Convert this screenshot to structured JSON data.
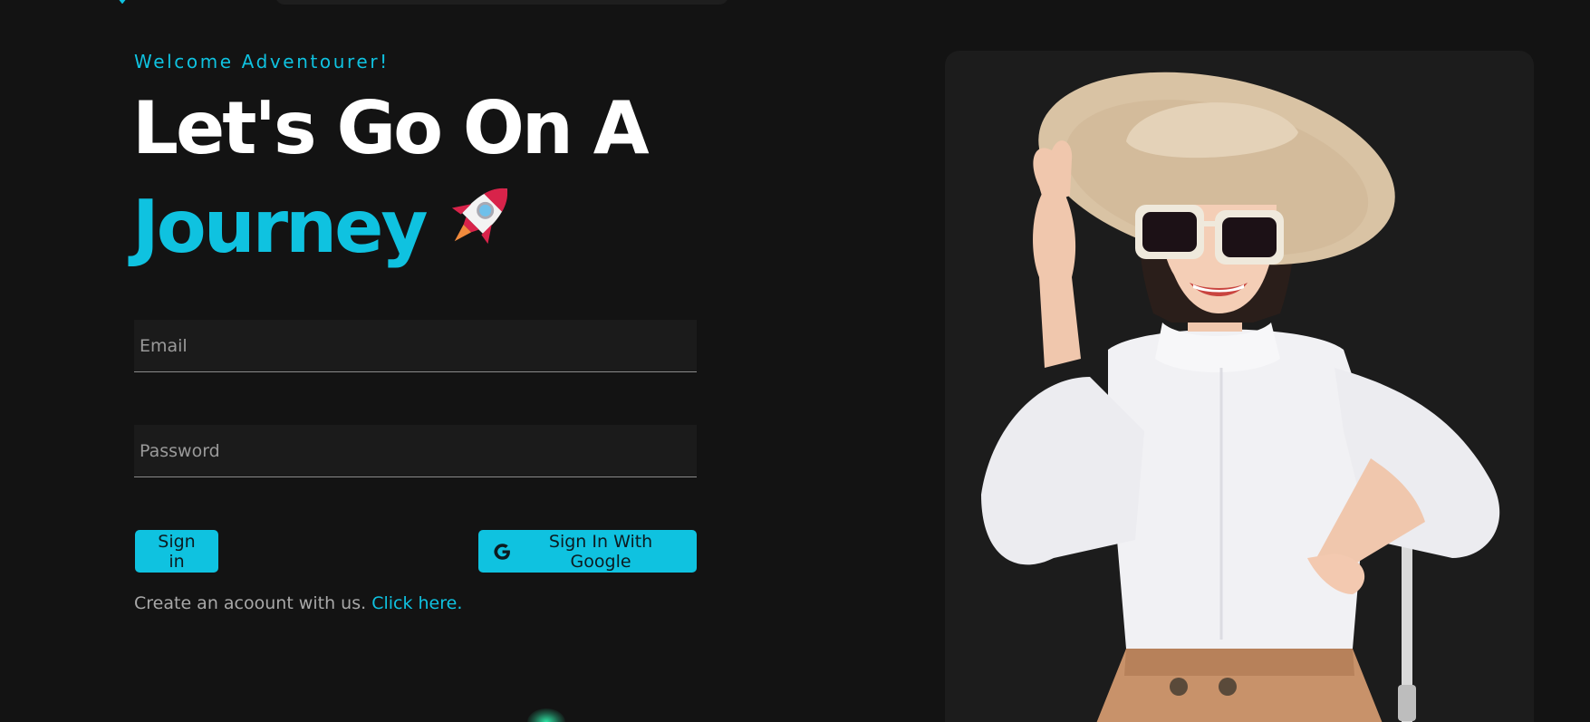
{
  "header": {
    "logo_icon": "compass-icon",
    "search_icon": "search-bar"
  },
  "login": {
    "welcome": "Welcome Adventourer!",
    "headline_line1": "Let's Go On A",
    "headline_line2": "Journey",
    "rocket_icon": "rocket-emoji",
    "email_placeholder": "Email",
    "password_placeholder": "Password",
    "signin_label": "Sign in",
    "google_label": "Sign In With Google",
    "google_icon": "google-g-icon",
    "signup_text": "Create an acoount with us.",
    "signup_link": "Click here."
  },
  "hero": {
    "image_subject": "traveler-woman-photo"
  },
  "colors": {
    "background": "#131313",
    "accent": "#0fc2e0",
    "card": "#1c1c1c",
    "field": "#1b1b1b"
  }
}
